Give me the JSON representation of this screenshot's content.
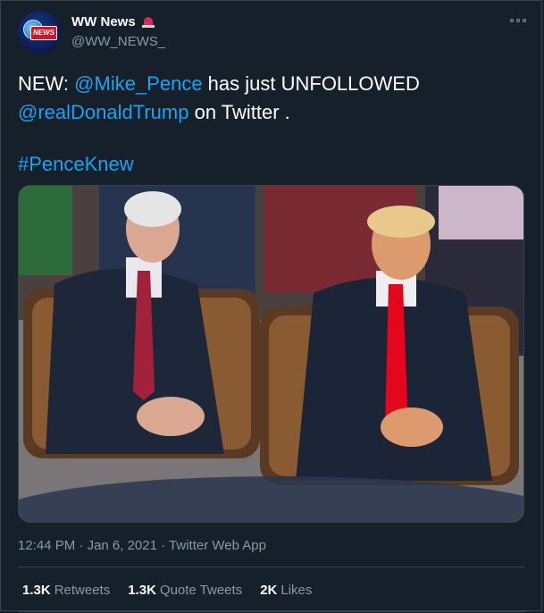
{
  "author": {
    "display_name": "WW News",
    "handle": "@WW_NEWS_",
    "avatar_badge": "NEWS",
    "verified_emoji_icon": "police-siren-icon"
  },
  "tweet": {
    "prefix": "NEW: ",
    "mention1": "@Mike_Pence",
    "middle": " has just UNFOLLOWED",
    "mention2": "@realDonaldTrump",
    "suffix": " on Twitter .",
    "hashtag": "#PenceKnew"
  },
  "meta": {
    "time": "12:44 PM",
    "separator1": " · ",
    "date": "Jan 6, 2021",
    "separator2": " · ",
    "source": "Twitter Web App"
  },
  "stats": [
    {
      "value": "1.3K",
      "label": "Retweets"
    },
    {
      "value": "1.3K",
      "label": "Quote Tweets"
    },
    {
      "value": "2K",
      "label": "Likes"
    }
  ],
  "colors": {
    "background": "#15202b",
    "link": "#1da1f2",
    "secondary_text": "#8899a6",
    "border": "#38444d"
  }
}
